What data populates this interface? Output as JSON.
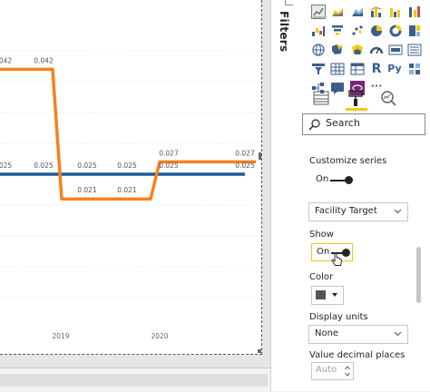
{
  "canvas": {
    "chart_data": {
      "type": "line",
      "x": [
        "",
        "",
        "2019",
        "",
        "2020",
        ""
      ],
      "xlabel": "",
      "ylabel": "",
      "series": [
        {
          "color": "#1f5b99",
          "values": [
            0.025,
            0.025,
            0.025,
            0.025,
            0.025,
            0.025
          ]
        },
        {
          "color": "#f5821f",
          "values": [
            0.042,
            0.042,
            0.021,
            0.021,
            0.027,
            0.027
          ]
        }
      ],
      "line_data_labels": [
        "025",
        "0.025",
        "0.025",
        "0.025",
        "0.025",
        "0.025"
      ],
      "step_data_labels": [
        "042",
        "0.042",
        "0.021",
        "0.021",
        "0.027",
        "0.027"
      ],
      "x_tick_labels": [
        "2019",
        "2020"
      ],
      "grid": true,
      "step_shape": true
    }
  },
  "filters": {
    "label": "Filters"
  },
  "viz_pane": {
    "text_icons": {
      "r": "R",
      "py": "Py",
      "more": "···"
    },
    "search": {
      "placeholder": "Search",
      "icon": "search-icon"
    },
    "customize_series": {
      "heading": "Customize series",
      "toggle_label": "On",
      "toggle_on": true
    },
    "series_dropdown": {
      "value": "Facility Target"
    },
    "show": {
      "heading": "Show",
      "toggle_label": "On",
      "toggle_on": true
    },
    "color": {
      "heading": "Color",
      "swatch": "#555555"
    },
    "display_units": {
      "heading": "Display units",
      "value": "None"
    },
    "decimal_places": {
      "heading": "Value decimal places",
      "value": "Auto"
    }
  },
  "colors": {
    "accent": "#f2c811",
    "line_blue": "#1f5b99",
    "line_orange": "#f5821f"
  }
}
